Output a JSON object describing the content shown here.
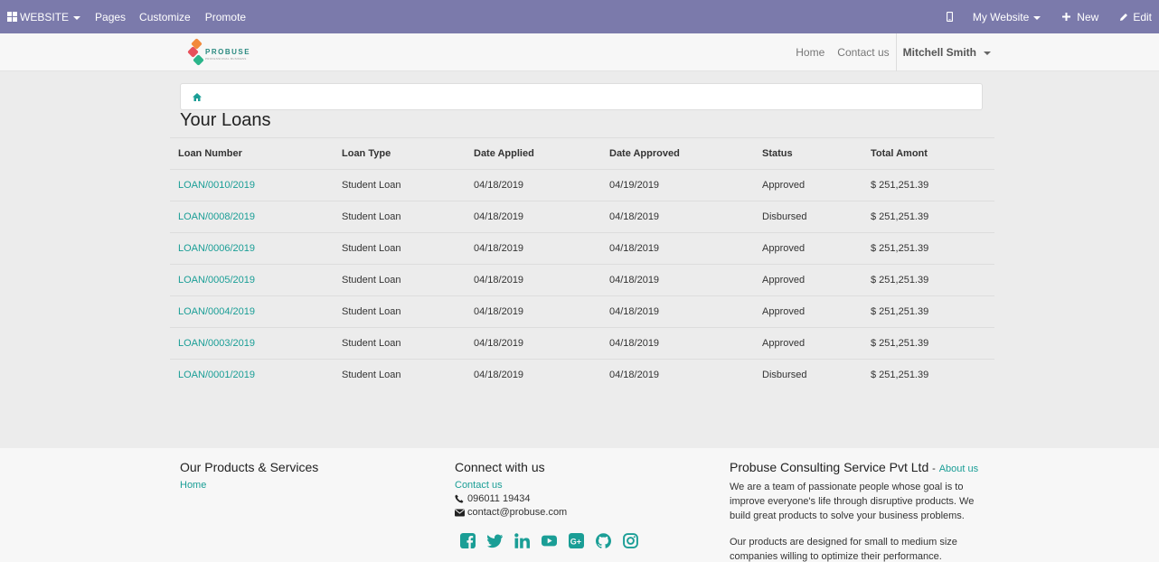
{
  "admin_bar": {
    "website_label": "WEBSITE",
    "pages_label": "Pages",
    "customize_label": "Customize",
    "promote_label": "Promote",
    "my_website_label": "My Website",
    "new_label": "New",
    "edit_label": "Edit"
  },
  "header": {
    "logo_text": "PROBUSE",
    "logo_subtext": "PROFESSIONAL BUSINESS",
    "nav": {
      "home": "Home",
      "contact": "Contact us",
      "user": "Mitchell Smith"
    }
  },
  "page_title": "Your Loans",
  "table": {
    "headers": [
      "Loan Number",
      "Loan Type",
      "Date Applied",
      "Date Approved",
      "Status",
      "Total Amont"
    ],
    "rows": [
      [
        "LOAN/0010/2019",
        "Student Loan",
        "04/18/2019",
        "04/19/2019",
        "Approved",
        "$ 251,251.39"
      ],
      [
        "LOAN/0008/2019",
        "Student Loan",
        "04/18/2019",
        "04/18/2019",
        "Disbursed",
        "$ 251,251.39"
      ],
      [
        "LOAN/0006/2019",
        "Student Loan",
        "04/18/2019",
        "04/18/2019",
        "Approved",
        "$ 251,251.39"
      ],
      [
        "LOAN/0005/2019",
        "Student Loan",
        "04/18/2019",
        "04/18/2019",
        "Approved",
        "$ 251,251.39"
      ],
      [
        "LOAN/0004/2019",
        "Student Loan",
        "04/18/2019",
        "04/18/2019",
        "Approved",
        "$ 251,251.39"
      ],
      [
        "LOAN/0003/2019",
        "Student Loan",
        "04/18/2019",
        "04/18/2019",
        "Approved",
        "$ 251,251.39"
      ],
      [
        "LOAN/0001/2019",
        "Student Loan",
        "04/18/2019",
        "04/18/2019",
        "Disbursed",
        "$ 251,251.39"
      ]
    ]
  },
  "footer": {
    "products": {
      "title": "Our Products & Services",
      "home_link": "Home"
    },
    "connect": {
      "title": "Connect with us",
      "contact_link": "Contact us",
      "phone": "096011 19434",
      "email": "contact@probuse.com",
      "socials": [
        "facebook-icon",
        "twitter-icon",
        "linkedin-icon",
        "youtube-icon",
        "google-plus-icon",
        "github-icon",
        "instagram-icon"
      ]
    },
    "company": {
      "title": "Probuse Consulting Service Pvt Ltd",
      "separator": "-",
      "about_link": "About us",
      "para1": "We are a team of passionate people whose goal is to improve everyone's life through disruptive products. We build great products to solve your business problems.",
      "para2": "Our products are designed for small to medium size companies willing to optimize their performance."
    }
  },
  "colors": {
    "admin_bar": "#7b7aab",
    "link": "#1a9e96",
    "footer_bg": "#f7f7f7",
    "page_bg": "#ececec"
  }
}
